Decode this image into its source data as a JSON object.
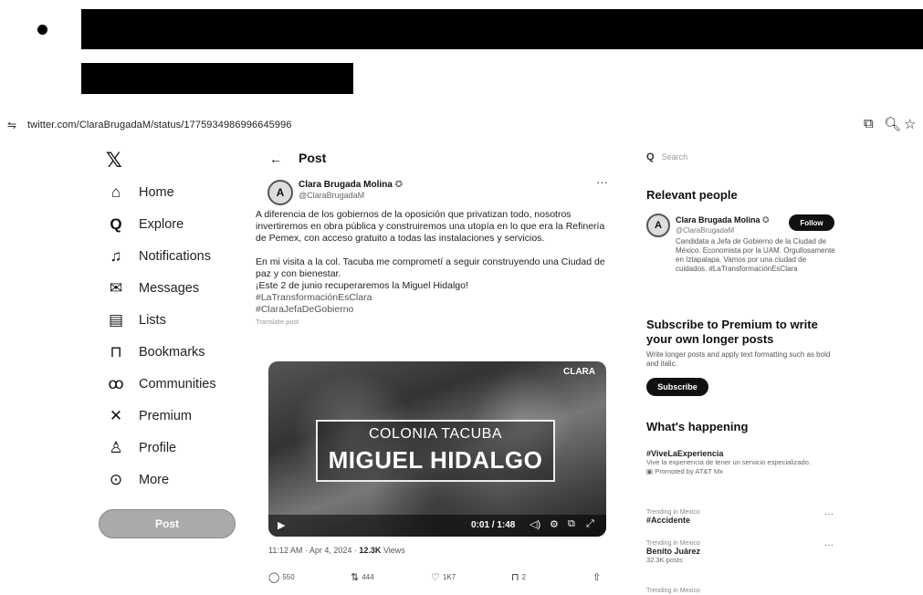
{
  "browser": {
    "url": "twitter.com/ClaraBrugadaM/status/1775934986996645996"
  },
  "sidebar": {
    "items": [
      {
        "label": "Home",
        "icon": "home-icon",
        "glyph": "⌂"
      },
      {
        "label": "Explore",
        "icon": "search-icon",
        "glyph": "Q"
      },
      {
        "label": "Notifications",
        "icon": "bell-icon",
        "glyph": "🔔"
      },
      {
        "label": "Messages",
        "icon": "envelope-icon",
        "glyph": "✉"
      },
      {
        "label": "Lists",
        "icon": "list-icon",
        "glyph": "☰"
      },
      {
        "label": "Bookmarks",
        "icon": "bookmark-icon",
        "glyph": "⊓"
      },
      {
        "label": "Communities",
        "icon": "communities-icon",
        "glyph": "ꝏ"
      },
      {
        "label": "Premium",
        "icon": "x-icon",
        "glyph": "✕"
      },
      {
        "label": "Profile",
        "icon": "profile-icon",
        "glyph": "♙"
      },
      {
        "label": "More",
        "icon": "more-icon",
        "glyph": "⊙"
      }
    ],
    "post_button": "Post"
  },
  "main": {
    "header_title": "Post",
    "author": {
      "name": "Clara Brugada Molina",
      "handle": "@ClaraBrugadaM"
    },
    "tweet": {
      "paragraph1": "A diferencia de los gobiernos de la oposición que privatizan todo, nosotros invertiremos en obra pública y construiremos una utopía en lo que era la Refinería de Pemex, con acceso gratuito a todas las instalaciones y servicios.",
      "paragraph2_line1": "En mi visita a la col. Tacuba me comprometí a seguir construyendo una Ciudad de paz y con bienestar.",
      "paragraph2_line2": "¡Este 2 de junio recuperaremos la Miguel Hidalgo!",
      "hashtag1": "#LaTransformaciónEsClara",
      "hashtag2": "#ClaraJefaDeGobierno",
      "translate": "Translate post"
    },
    "media": {
      "overlay_subtitle": "COLONIA TACUBA",
      "overlay_title": "MIGUEL HIDALGO",
      "corner_logo": "CLARA",
      "video_time": "0:01 / 1:48"
    },
    "meta": {
      "time": "11:12 AM · Apr 4, 2024 · ",
      "views": "12.3K",
      "views_label": " Views"
    },
    "actions": {
      "replies": "550",
      "reposts": "444",
      "likes": "1K7",
      "bookmarks": "2"
    }
  },
  "right": {
    "search_placeholder": "Search",
    "relevant_title": "Relevant people",
    "person": {
      "name": "Clara Brugada Molina",
      "handle": "@ClaraBrugadaM",
      "follow_label": "Follow",
      "bio": "Candidata a Jefa de Gobierno de la Ciudad de México. Economista por la UAM. Orgullosamente en Iztapalapa. Vamos por una ciudad de cuidados. #LaTransformaciónEsClara"
    },
    "premium": {
      "title": "Subscribe to Premium to write your own longer posts",
      "desc": "Write longer posts and apply text formatting such as bold and italic.",
      "button": "Subscribe"
    },
    "happening_title": "What's happening",
    "trends": [
      {
        "name": "#ViveLaExperiencia",
        "desc": "Vive la experiencia de tener un servicio especializado.",
        "promo": "Promoted by AT&T Mx"
      },
      {
        "context": "Trending in Mexico",
        "name": "#Accidente"
      },
      {
        "context": "Trending in Mexico",
        "name": "Benito Juárez",
        "count": "32.3K posts"
      },
      {
        "context": "Trending in Mexico"
      }
    ]
  }
}
